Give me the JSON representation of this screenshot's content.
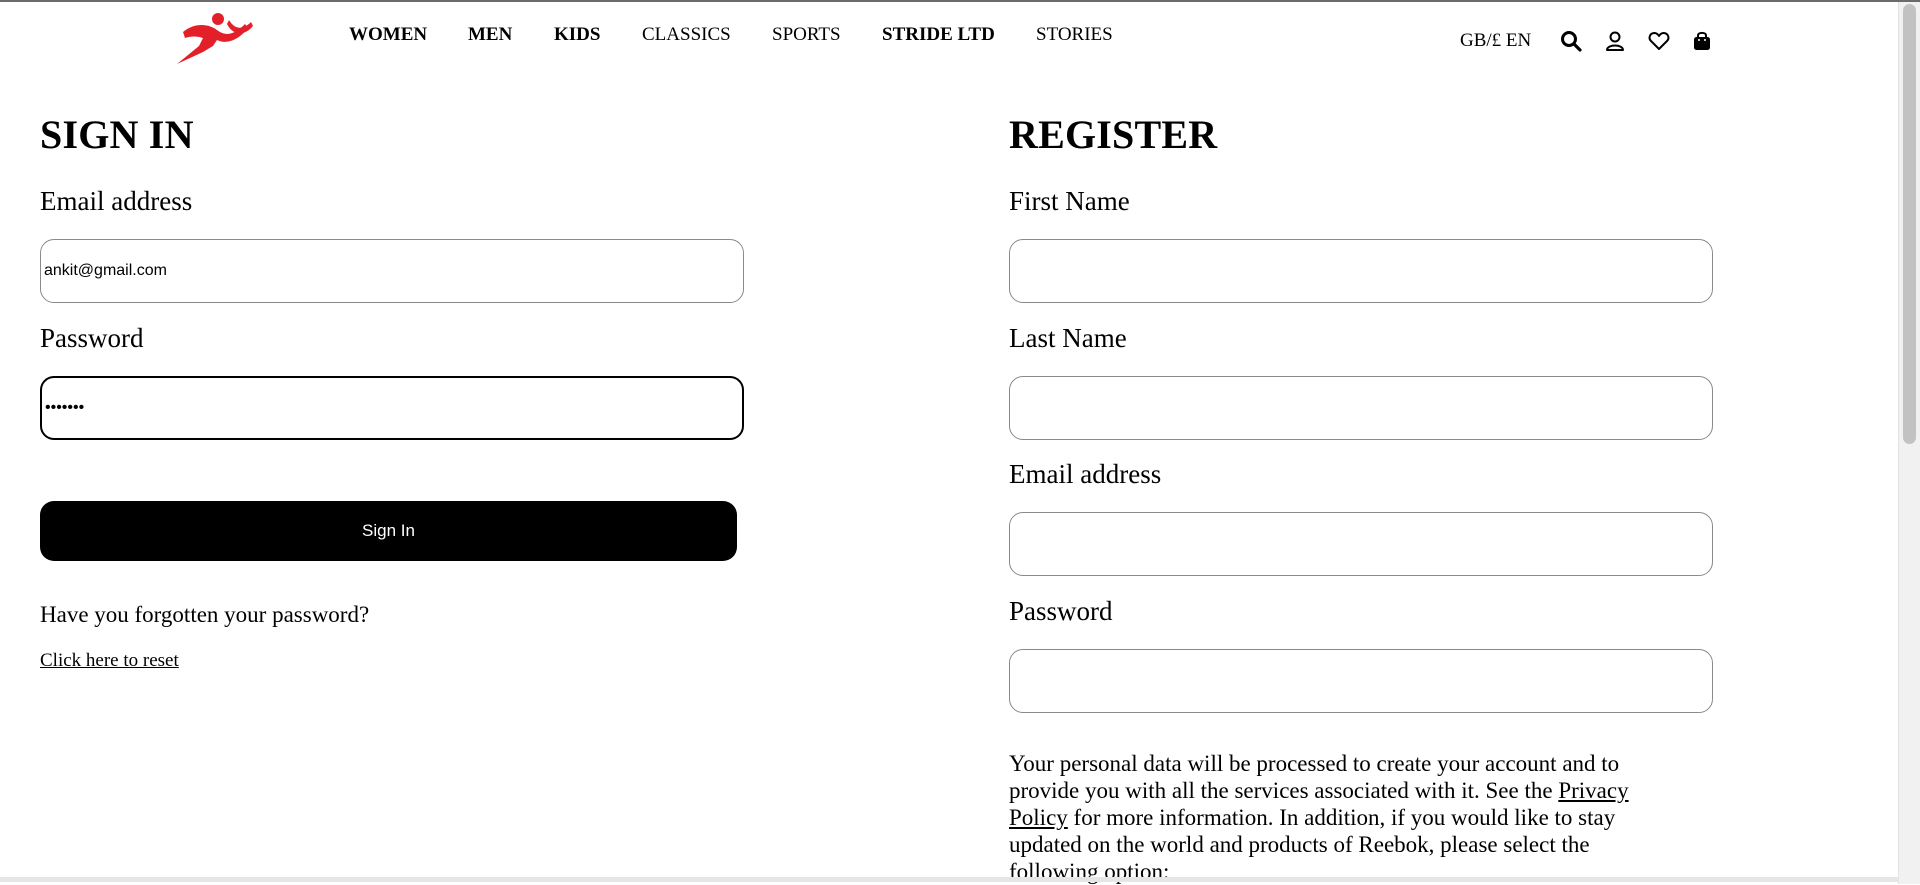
{
  "brand": {
    "logo_icon": "runner-logo-icon",
    "accent_color": "#e3202a"
  },
  "nav": {
    "items": [
      {
        "label": "WOMEN",
        "bold": true
      },
      {
        "label": "MEN",
        "bold": true
      },
      {
        "label": "KIDS",
        "bold": true
      },
      {
        "label": "CLASSICS",
        "bold": false
      },
      {
        "label": "SPORTS",
        "bold": false
      },
      {
        "label": "STRIDE LTD",
        "bold": true
      },
      {
        "label": "STORIES",
        "bold": false
      }
    ]
  },
  "header": {
    "locale": "GB/£ EN",
    "icons": [
      "search-icon",
      "user-icon",
      "heart-icon",
      "bag-icon"
    ]
  },
  "signin": {
    "title": "SIGN IN",
    "email_label": "Email address",
    "email_value": "ankit@gmail.com",
    "password_label": "Password",
    "password_value": "•••••••",
    "button": "Sign In",
    "forgot_text": "Have you forgotten your password?",
    "reset_link": "Click here to reset"
  },
  "register": {
    "title": "REGISTER",
    "first_name_label": "First Name",
    "last_name_label": "Last Name",
    "email_label": "Email address",
    "password_label": "Password",
    "privacy_text_1": "Your personal data will be processed to create your account and to provide you with all the services associated with it. See the ",
    "privacy_link": "Privacy Policy",
    "privacy_text_2": " for more information. In addition, if you would like to stay updated on the world and products of Reebok, please select the following option:"
  }
}
